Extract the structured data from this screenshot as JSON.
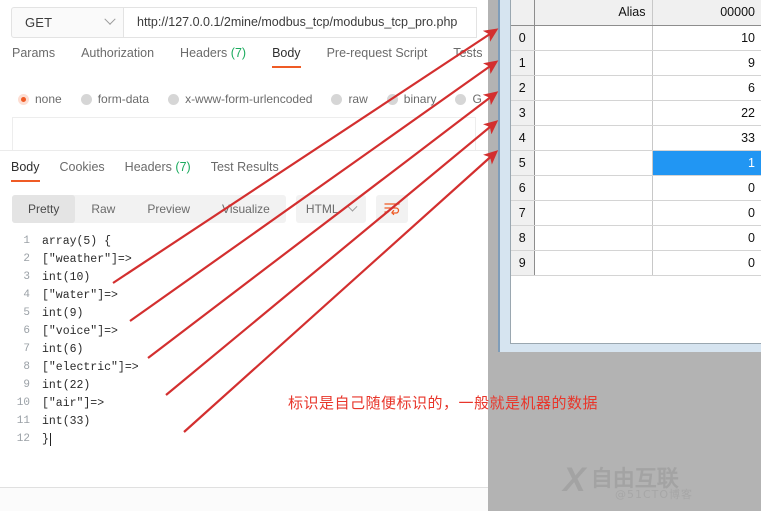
{
  "request": {
    "method": "GET",
    "url": "http://127.0.0.1/2mine/modbus_tcp/modubus_tcp_pro.php",
    "tabs": [
      {
        "label": "Params",
        "active": false
      },
      {
        "label": "Authorization",
        "active": false
      },
      {
        "label": "Headers",
        "count": "(7)",
        "active": false
      },
      {
        "label": "Body",
        "active": true
      },
      {
        "label": "Pre-request Script",
        "active": false
      },
      {
        "label": "Tests",
        "active": false
      }
    ],
    "body_types": [
      {
        "label": "none",
        "selected": true
      },
      {
        "label": "form-data",
        "selected": false
      },
      {
        "label": "x-www-form-urlencoded",
        "selected": false
      },
      {
        "label": "raw",
        "selected": false
      },
      {
        "label": "binary",
        "selected": false
      },
      {
        "label": "G",
        "selected": false
      }
    ]
  },
  "response": {
    "tabs": [
      {
        "label": "Body",
        "active": true
      },
      {
        "label": "Cookies",
        "active": false
      },
      {
        "label": "Headers",
        "count": "(7)",
        "active": false
      },
      {
        "label": "Test Results",
        "active": false
      }
    ],
    "views": [
      {
        "label": "Pretty",
        "active": true
      },
      {
        "label": "Raw",
        "active": false
      },
      {
        "label": "Preview",
        "active": false
      },
      {
        "label": "Visualize",
        "active": false
      }
    ],
    "format": "HTML",
    "code_lines": [
      {
        "n": "1",
        "text": "array(5) {"
      },
      {
        "n": "2",
        "text": "[\"weather\"]=>"
      },
      {
        "n": "3",
        "text": "int(10)"
      },
      {
        "n": "4",
        "text": "[\"water\"]=>"
      },
      {
        "n": "5",
        "text": "int(9)"
      },
      {
        "n": "6",
        "text": "[\"voice\"]=>"
      },
      {
        "n": "7",
        "text": "int(6)"
      },
      {
        "n": "8",
        "text": "[\"electric\"]=>"
      },
      {
        "n": "9",
        "text": "int(22)"
      },
      {
        "n": "10",
        "text": "[\"air\"]=>"
      },
      {
        "n": "11",
        "text": "int(33)"
      },
      {
        "n": "12",
        "text": "}"
      }
    ]
  },
  "modbus": {
    "headers": {
      "index": "",
      "alias": "Alias",
      "address": "00000"
    },
    "rows": [
      {
        "index": "0",
        "alias": "",
        "value": "10",
        "selected": false
      },
      {
        "index": "1",
        "alias": "",
        "value": "9",
        "selected": false
      },
      {
        "index": "2",
        "alias": "",
        "value": "6",
        "selected": false
      },
      {
        "index": "3",
        "alias": "",
        "value": "22",
        "selected": false
      },
      {
        "index": "4",
        "alias": "",
        "value": "33",
        "selected": false
      },
      {
        "index": "5",
        "alias": "",
        "value": "1",
        "selected": true
      },
      {
        "index": "6",
        "alias": "",
        "value": "0",
        "selected": false
      },
      {
        "index": "7",
        "alias": "",
        "value": "0",
        "selected": false
      },
      {
        "index": "8",
        "alias": "",
        "value": "0",
        "selected": false
      },
      {
        "index": "9",
        "alias": "",
        "value": "0",
        "selected": false
      }
    ]
  },
  "annotation": {
    "text": "标识是自己随便标识的，一般就是机器的数据",
    "color": "#e8362b",
    "arrow_color": "#d32f2f",
    "arrow_count": 5
  },
  "watermark": {
    "mark": "X",
    "title": "自由互联",
    "subtitle": "@51CTO博客"
  },
  "colors": {
    "accent": "#ef5b25",
    "selection": "#2196f3",
    "count_green": "#1bab5e"
  }
}
